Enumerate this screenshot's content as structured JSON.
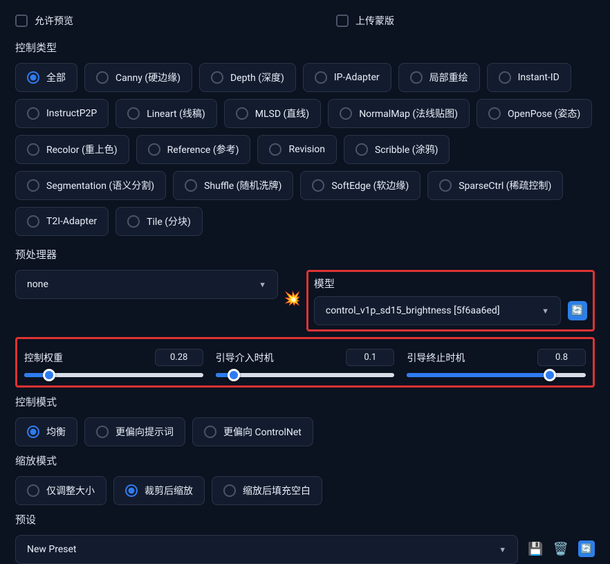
{
  "checkboxes": {
    "allow_preview": "允许预览",
    "upload_mask": "上传蒙版"
  },
  "control_type": {
    "label": "控制类型",
    "options": [
      "全部",
      "Canny (硬边缘)",
      "Depth (深度)",
      "IP-Adapter",
      "局部重绘",
      "Instant-ID",
      "InstructP2P",
      "Lineart (线稿)",
      "MLSD (直线)",
      "NormalMap (法线贴图)",
      "OpenPose (姿态)",
      "Recolor (重上色)",
      "Reference (参考)",
      "Revision",
      "Scribble (涂鸦)",
      "Segmentation (语义分割)",
      "Shuffle (随机洗牌)",
      "SoftEdge (软边缘)",
      "SparseCtrl (稀疏控制)",
      "T2I-Adapter",
      "Tile (分块)"
    ],
    "selected": 0
  },
  "preprocessor": {
    "label": "预处理器",
    "value": "none"
  },
  "model": {
    "label": "模型",
    "value": "control_v1p_sd15_brightness [5f6aa6ed]"
  },
  "sliders": {
    "weight": {
      "label": "控制权重",
      "value": "0.28",
      "percent": 14
    },
    "start": {
      "label": "引导介入时机",
      "value": "0.1",
      "percent": 10
    },
    "end": {
      "label": "引导终止时机",
      "value": "0.8",
      "percent": 80
    }
  },
  "control_mode": {
    "label": "控制模式",
    "options": [
      "均衡",
      "更偏向提示词",
      "更偏向 ControlNet"
    ],
    "selected": 0
  },
  "resize_mode": {
    "label": "缩放模式",
    "options": [
      "仅调整大小",
      "裁剪后缩放",
      "缩放后填充空白"
    ],
    "selected": 1
  },
  "preset": {
    "label": "预设",
    "value": "New Preset"
  }
}
